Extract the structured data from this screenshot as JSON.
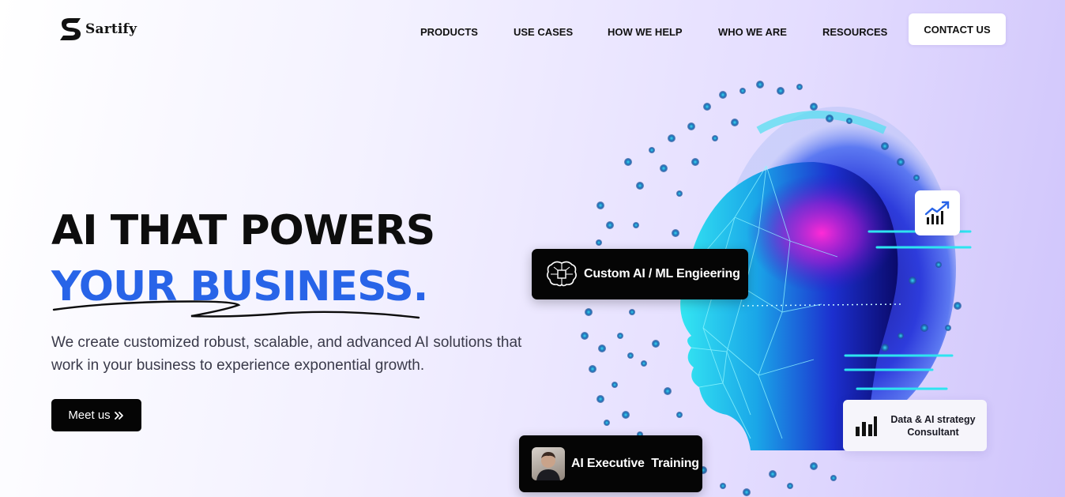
{
  "brand": {
    "name": "Sartify"
  },
  "nav": {
    "items": [
      {
        "label": "PRODUCTS"
      },
      {
        "label": "USE CASES"
      },
      {
        "label": "HOW WE HELP"
      },
      {
        "label": "WHO WE ARE"
      },
      {
        "label": "RESOURCES"
      }
    ],
    "contact_label": "CONTACT US"
  },
  "hero": {
    "headline_line1": "AI THAT POWERS",
    "headline_line2": "YOUR BUSINESS.",
    "subtext": "We create customized robust, scalable, and advanced AI solutions that work in your business to experience exponential growth.",
    "cta_label": "Meet us",
    "cta_icon": "double-chevron-right-icon"
  },
  "cards": {
    "ml": {
      "label": "Custom AI / ML Engieering",
      "icon": "brain-chip-icon"
    },
    "exec": {
      "label": "AI Executive  Training",
      "icon": "avatar"
    },
    "data": {
      "label": "Data & AI strategy Consultant",
      "icon": "bar-chart-icon"
    },
    "growth": {
      "icon": "growth-chart-icon"
    }
  },
  "colors": {
    "accent_blue": "#2864e8",
    "dark": "#050505",
    "cyan": "#1fd3e8",
    "magenta": "#e21ad1"
  }
}
